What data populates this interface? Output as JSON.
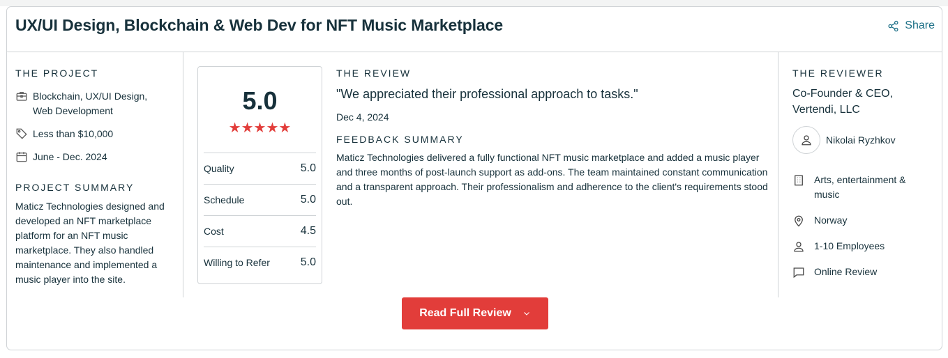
{
  "header": {
    "title": "UX/UI Design, Blockchain & Web Dev for NFT Music Marketplace",
    "share_label": "Share"
  },
  "project": {
    "section_label": "THE PROJECT",
    "services": "Blockchain, UX/UI Design, Web Development",
    "budget": "Less than $10,000",
    "dates": "June - Dec. 2024",
    "summary_label": "PROJECT SUMMARY",
    "summary": "Maticz Technologies designed and developed an NFT marketplace platform for an NFT music marketplace. They also handled maintenance and implemented a music player into the site."
  },
  "rating": {
    "overall": "5.0",
    "stars": 5,
    "rows": [
      {
        "label": "Quality",
        "value": "5.0"
      },
      {
        "label": "Schedule",
        "value": "5.0"
      },
      {
        "label": "Cost",
        "value": "4.5"
      },
      {
        "label": "Willing to Refer",
        "value": "5.0"
      }
    ]
  },
  "review": {
    "section_label": "THE REVIEW",
    "quote": "\"We appreciated their professional approach to tasks.\"",
    "date": "Dec 4, 2024",
    "feedback_label": "FEEDBACK SUMMARY",
    "feedback": "Maticz Technologies delivered a fully functional NFT music marketplace and added a music player and three months of post-launch support as add-ons. The team maintained constant communication and a transparent approach. Their professionalism and adherence to the client's requirements stood out."
  },
  "reviewer": {
    "section_label": "THE REVIEWER",
    "role": "Co-Founder & CEO, Vertendi, LLC",
    "name": "Nikolai Ryzhkov",
    "industry": "Arts, entertainment & music",
    "location": "Norway",
    "size": "1-10 Employees",
    "review_type": "Online Review"
  },
  "cta": {
    "label": "Read Full Review"
  },
  "colors": {
    "accent": "#e23d3a",
    "link": "#1b6f86",
    "text": "#17313b",
    "border": "#cfd3d6"
  }
}
